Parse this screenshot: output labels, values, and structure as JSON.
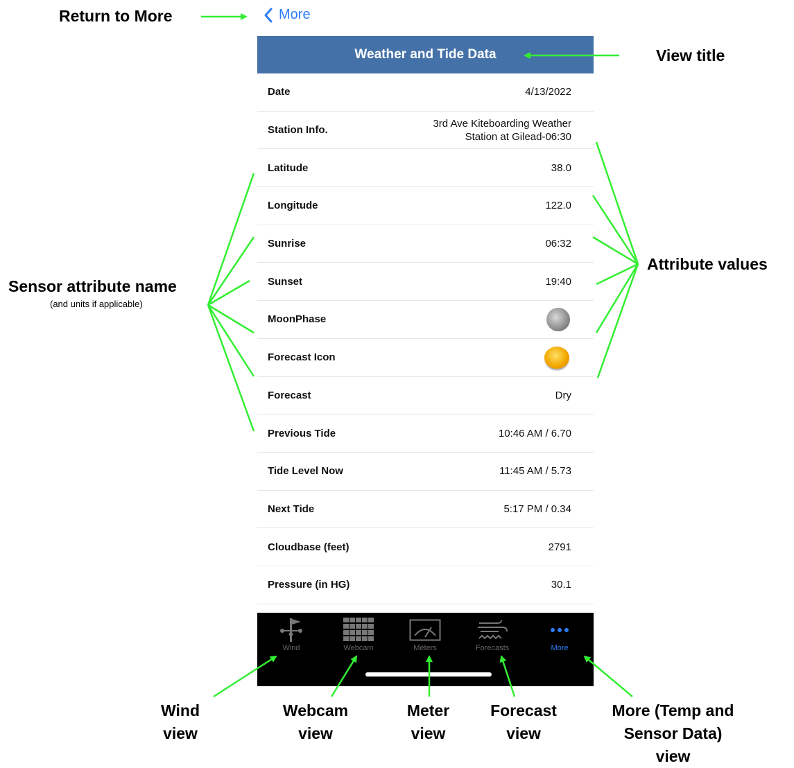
{
  "nav": {
    "back_label": "More"
  },
  "title": "Weather and Tide Data",
  "rows": [
    {
      "name": "Date",
      "value": "4/13/2022"
    },
    {
      "name": "Station Info.",
      "value": "3rd Ave Kiteboarding Weather",
      "value2": "Station at Gilead-06:30"
    },
    {
      "name": "Latitude",
      "value": "38.0"
    },
    {
      "name": "Longitude",
      "value": "122.0"
    },
    {
      "name": "Sunrise",
      "value": "06:32"
    },
    {
      "name": "Sunset",
      "value": "19:40"
    },
    {
      "name": "MoonPhase",
      "icon": "moon-phase-icon"
    },
    {
      "name": "Forecast Icon",
      "icon": "sun-forecast-icon"
    },
    {
      "name": "Forecast",
      "value": "Dry"
    },
    {
      "name": "Previous Tide",
      "value": "10:46 AM / 6.70"
    },
    {
      "name": "Tide Level Now",
      "value": "11:45 AM / 5.73"
    },
    {
      "name": "Next Tide",
      "value": "5:17 PM / 0.34"
    },
    {
      "name": "Cloudbase (feet)",
      "value": "2791"
    },
    {
      "name": "Pressure (in HG)",
      "value": "30.1"
    }
  ],
  "tabs": [
    {
      "label": "Wind",
      "icon": "wind-vane-icon"
    },
    {
      "label": "Webcam",
      "icon": "webcam-grid-icon"
    },
    {
      "label": "Meters",
      "icon": "meter-icon"
    },
    {
      "label": "Forecasts",
      "icon": "forecast-wind-icon"
    },
    {
      "label": "More",
      "icon": "more-dots-icon",
      "active": true
    }
  ],
  "annotations": {
    "return_to_more": "Return to More",
    "view_title": "View title",
    "attribute_values": "Attribute values",
    "sensor_attr_name": "Sensor attribute name",
    "sensor_attr_sub": "(and units if applicable)",
    "wind_1": "Wind",
    "wind_2": "view",
    "webcam_1": "Webcam",
    "webcam_2": "view",
    "meter_1": "Meter",
    "meter_2": "view",
    "forecast_1": "Forecast",
    "forecast_2": "view",
    "more_1": "More (Temp and",
    "more_2": "Sensor Data)",
    "more_3": "view"
  },
  "colors": {
    "accent": "#2f7cf6",
    "title_bar": "#4471a8",
    "arrow": "#33ee33"
  }
}
